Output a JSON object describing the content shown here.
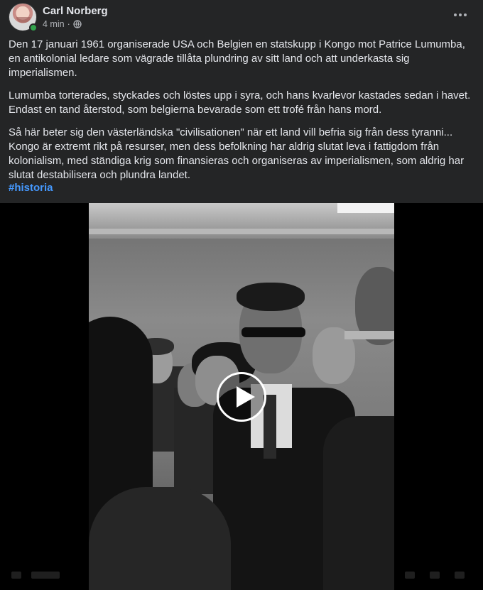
{
  "post": {
    "author": "Carl Norberg",
    "time": "4 min",
    "separator": "·",
    "paragraphs": [
      "Den 17 januari 1961 organiserade USA och Belgien en statskupp i Kongo mot Patrice Lumumba, en antikolonial ledare som vägrade tillåta plundring av sitt land och att underkasta sig imperialismen.",
      "Lumumba torterades, styckades och löstes upp i syra, och hans kvarlevor kastades sedan i havet. Endast en tand återstod, som belgierna bevarade som ett trofé från hans mord.",
      "Så här beter sig den västerländska \"civilisationen\" när ett land vill befria sig från dess tyranni... Kongo är extremt rikt på resurser, men dess befolkning har aldrig slutat leva i fattigdom från kolonialism, med ständiga krig som finansieras och organiseras av imperialismen, som aldrig har slutat destabilisera och plundra landet."
    ],
    "hashtag": "#historia"
  },
  "icons": {
    "privacy": "globe-icon",
    "more": "more-options-icon",
    "play": "play-icon"
  },
  "colors": {
    "background": "#242526",
    "text": "#e4e6eb",
    "secondary_text": "#b0b3b8",
    "hashtag": "#4599ff",
    "online": "#31a24c"
  }
}
